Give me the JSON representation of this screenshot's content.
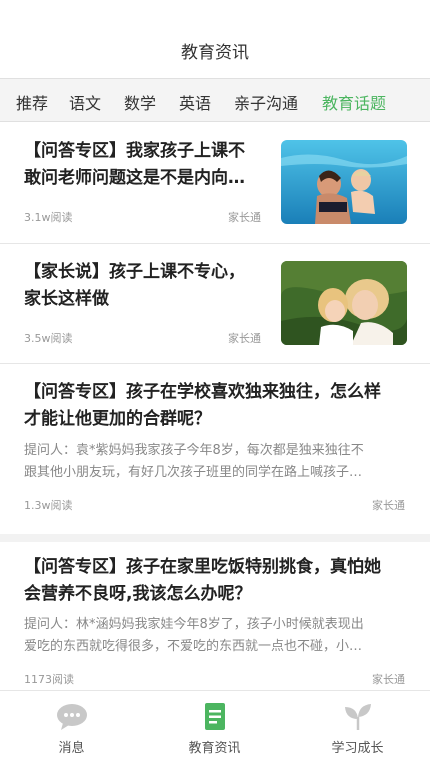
{
  "header": {
    "title": "教育资讯"
  },
  "tabs": [
    {
      "label": "推荐"
    },
    {
      "label": "语文"
    },
    {
      "label": "数学"
    },
    {
      "label": "英语"
    },
    {
      "label": "亲子沟通"
    },
    {
      "label": "教育话题",
      "active": true
    }
  ],
  "articles": [
    {
      "title_line1": "【问答专区】我家孩子上课不",
      "title_line2": "敢问老师问题这是不是内向…",
      "reads": "3.1w阅读",
      "source": "家长通",
      "thumbnail": "swimming-photo"
    },
    {
      "title_line1": "【家长说】孩子上课不专心，",
      "title_line2": "家长这样做",
      "reads": "3.5w阅读",
      "source": "家长通",
      "thumbnail": "mother-child-photo"
    },
    {
      "title_line1": "【问答专区】孩子在学校喜欢独来独往，怎么样",
      "title_line2": "才能让他更加的合群呢？",
      "excerpt_line1": "提问人：袁*紫妈妈我家孩子今年8岁，每次都是独来独往不",
      "excerpt_line2": "跟其他小朋友玩，有好几次孩子班里的同学在路上喊孩子…",
      "reads": "1.3w阅读",
      "source": "家长通"
    },
    {
      "title_line1": "【问答专区】孩子在家里吃饭特别挑食，真怕她",
      "title_line2": "会营养不良呀,我该怎么办呢？",
      "excerpt_line1": "提问人：林*涵妈妈我家娃今年8岁了，孩子小时候就表现出",
      "excerpt_line2": "爱吃的东西就吃得很多，不爱吃的东西就一点也不碰，小…",
      "reads": "1173阅读",
      "source": "家长通"
    }
  ],
  "bottom_nav": [
    {
      "label": "消息",
      "icon": "chat-bubble-icon"
    },
    {
      "label": "教育资讯",
      "icon": "news-document-icon",
      "active": true
    },
    {
      "label": "学习成长",
      "icon": "sprout-leaf-icon"
    }
  ],
  "colors": {
    "accent": "#4cb560",
    "inactive_icon": "#c8c8c8"
  }
}
